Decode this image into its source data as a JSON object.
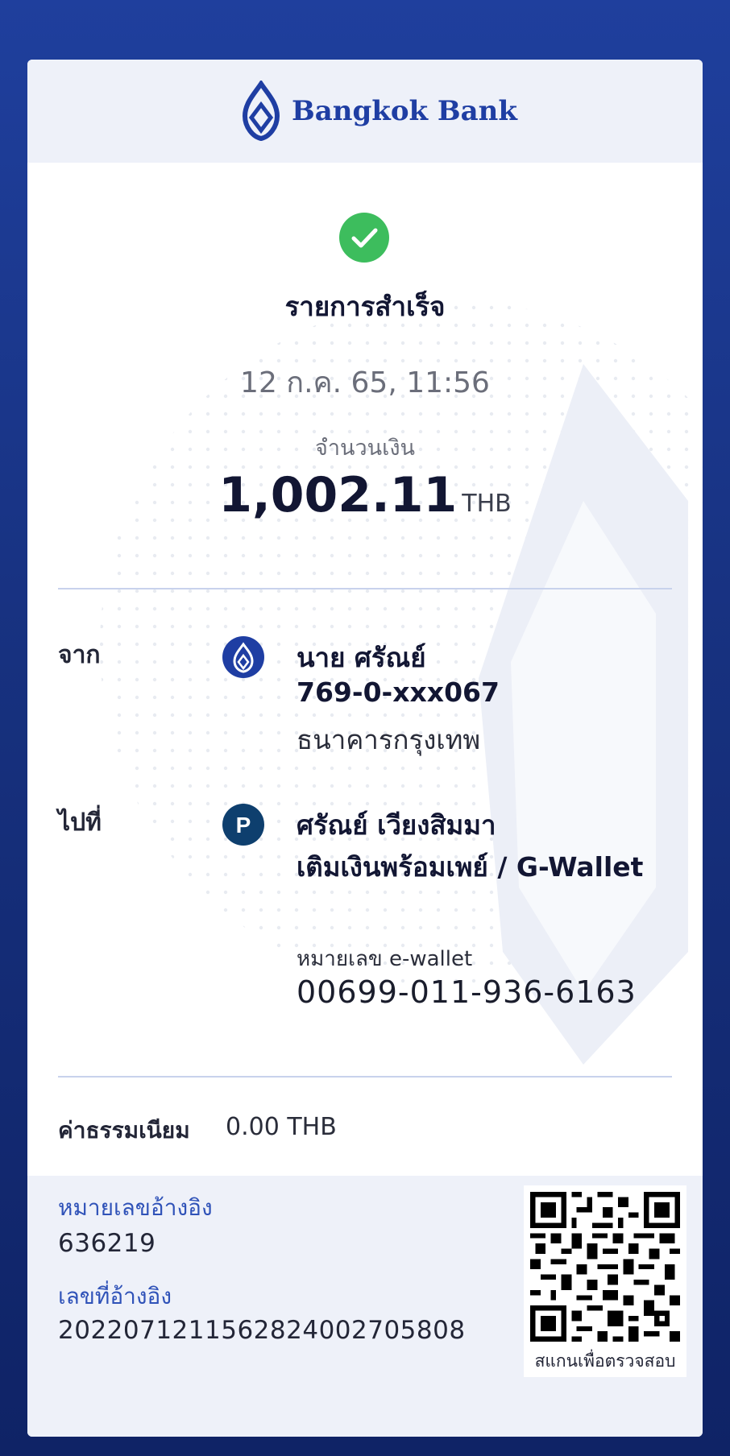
{
  "brand": {
    "name": "Bangkok Bank",
    "color": "#1f3ea3"
  },
  "status": {
    "title": "รายการสำเร็จ",
    "icon": "check-circle-icon",
    "color": "#3dbd5d"
  },
  "datetime": "12 ก.ค. 65, 11:56",
  "amount": {
    "label": "จำนวนเงิน",
    "value": "1,002.11",
    "currency": "THB"
  },
  "from": {
    "label": "จาก",
    "icon": "bangkok-bank-logo-icon",
    "name": "นาย ศรัณย์",
    "account": "769-0-xxx067",
    "bank": "ธนาคารกรุงเทพ"
  },
  "to": {
    "label": "ไปที่",
    "icon": "promptpay-p-icon",
    "name": "ศรัณย์ เวียงสิมมา",
    "service": "เติมเงินพร้อมเพย์ / G-Wallet",
    "wallet_label": "หมายเลข e-wallet",
    "wallet_number": "00699-011-936-6163"
  },
  "fee": {
    "label": "ค่าธรรมเนียม",
    "value": "0.00 THB"
  },
  "reference": {
    "ref_label": "หมายเลขอ้างอิง",
    "ref_value": "636219",
    "txn_label": "เลขที่อ้างอิง",
    "txn_value": "2022071211562824002705808"
  },
  "qr": {
    "caption": "สแกนเพื่อตรวจสอบ",
    "icon": "qr-code-icon"
  }
}
